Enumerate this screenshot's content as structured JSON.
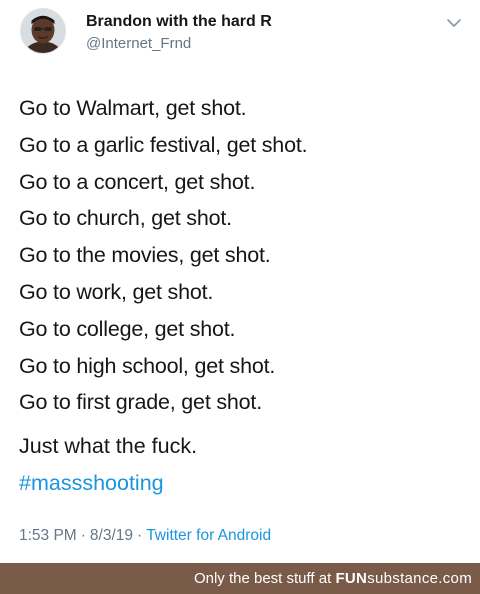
{
  "user": {
    "display_name": "Brandon with the hard R",
    "handle": "@Internet_Frnd"
  },
  "tweet": {
    "lines": [
      "Go to Walmart, get shot.",
      "Go to a garlic festival, get shot.",
      "Go to a concert, get shot.",
      "Go to church, get shot.",
      "Go to the movies, get shot.",
      "Go to work, get shot.",
      "Go to college, get shot.",
      "Go to high school, get shot.",
      "Go to first grade, get shot."
    ],
    "closing": "Just what the fuck.",
    "hashtag": "#massshooting"
  },
  "meta": {
    "time": "1:53 PM",
    "separator": "·",
    "date": "8/3/19",
    "client": "Twitter for Android"
  },
  "footer": {
    "tagline": "Only the best stuff at",
    "brand_main": "FUN",
    "brand_sub": "substance",
    "brand_domain": ".com"
  },
  "icons": {
    "avatar": "avatar-portrait",
    "caret": "chevron-down-icon"
  },
  "colors": {
    "text": "#14171a",
    "secondary": "#657786",
    "link": "#1b95e0",
    "footer_bg": "#7a5b49"
  }
}
